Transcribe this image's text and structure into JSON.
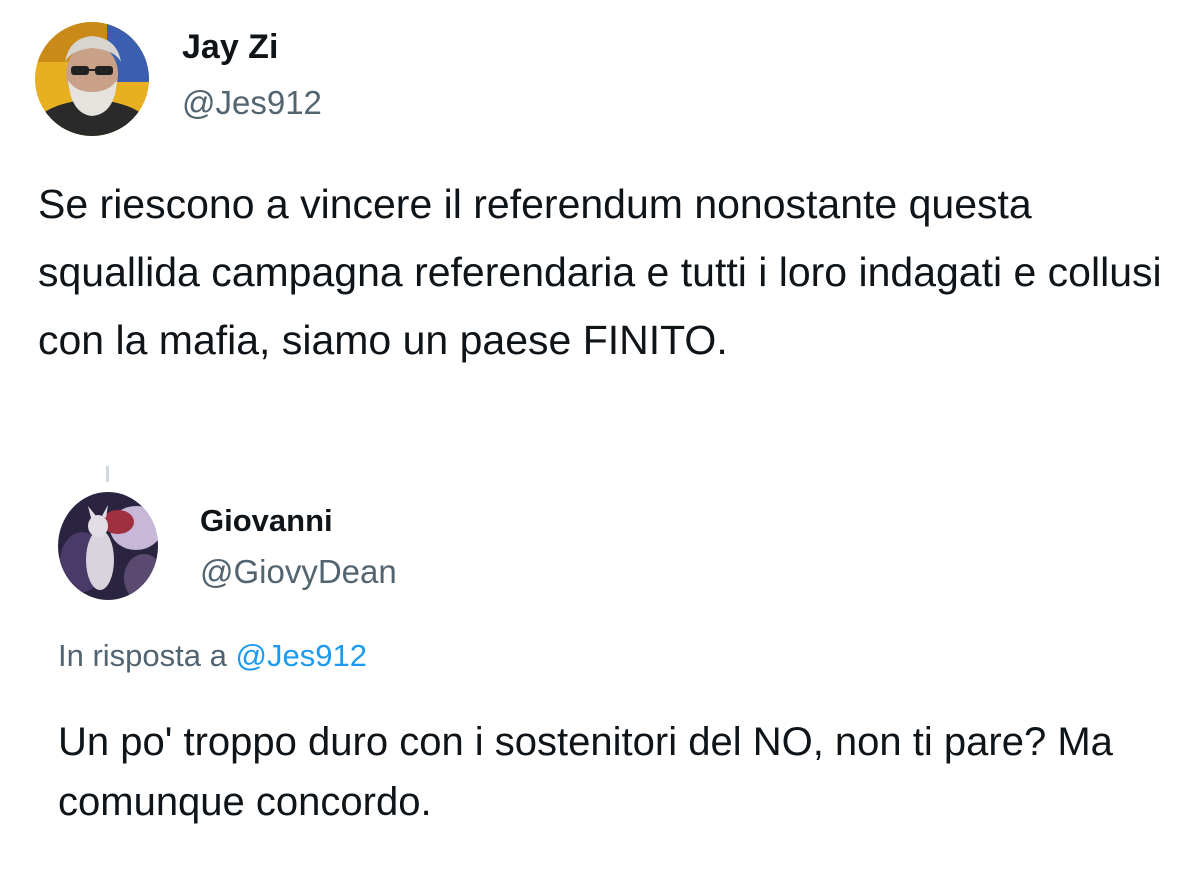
{
  "tweet": {
    "author": {
      "name": "Jay Zi",
      "handle": "@Jes912"
    },
    "text": "Se riescono a vincere il referendum nonostante questa squallida campagna referendaria e tutti i loro indagati e collusi con la mafia, siamo un paese FINITO."
  },
  "reply": {
    "author": {
      "name": "Giovanni",
      "handle": "@GiovyDean"
    },
    "context_prefix": "In risposta a",
    "context_mention": "@Jes912",
    "text": "Un po' troppo duro con i sostenitori del NO, non ti pare? Ma comunque concordo."
  },
  "colors": {
    "text_primary": "#0f1419",
    "text_secondary": "#536471",
    "mention": "#1d9bf0",
    "thread_line": "#cfd9de"
  }
}
